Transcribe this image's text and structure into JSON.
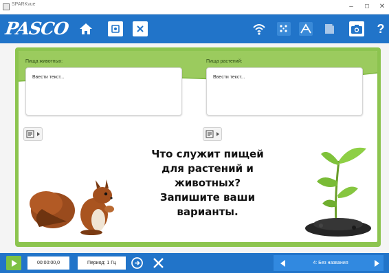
{
  "window": {
    "title": "SPARKvue",
    "minimize": "–",
    "maximize": "☐",
    "close": "✕"
  },
  "toolbar": {
    "logo": "PASCO",
    "left_buttons": [
      "home-icon",
      "journal-icon",
      "close-document-icon"
    ],
    "right_buttons": [
      "wireless-sensor-icon",
      "experiment-tools-icon",
      "data-analysis-icon",
      "journal-snapshot-icon",
      "camera-icon",
      "help-icon"
    ],
    "help_label": "?"
  },
  "page": {
    "animals_label": "Пища животных:",
    "animals_placeholder": "Ввести текст...",
    "plants_label": "Пища растений:",
    "plants_placeholder": "Ввести текст...",
    "question": "Что служит пищей\nдля растений и\nживотных?\nЗапишите ваши\nварианты."
  },
  "bottom": {
    "timer": "00:00:00,0",
    "period": "Период: 1 Гц",
    "page_title": "4: Без названия"
  },
  "colors": {
    "toolbar_blue": "#2174c9",
    "workspace_green": "#8cc44f",
    "play_green": "#7dc143"
  }
}
